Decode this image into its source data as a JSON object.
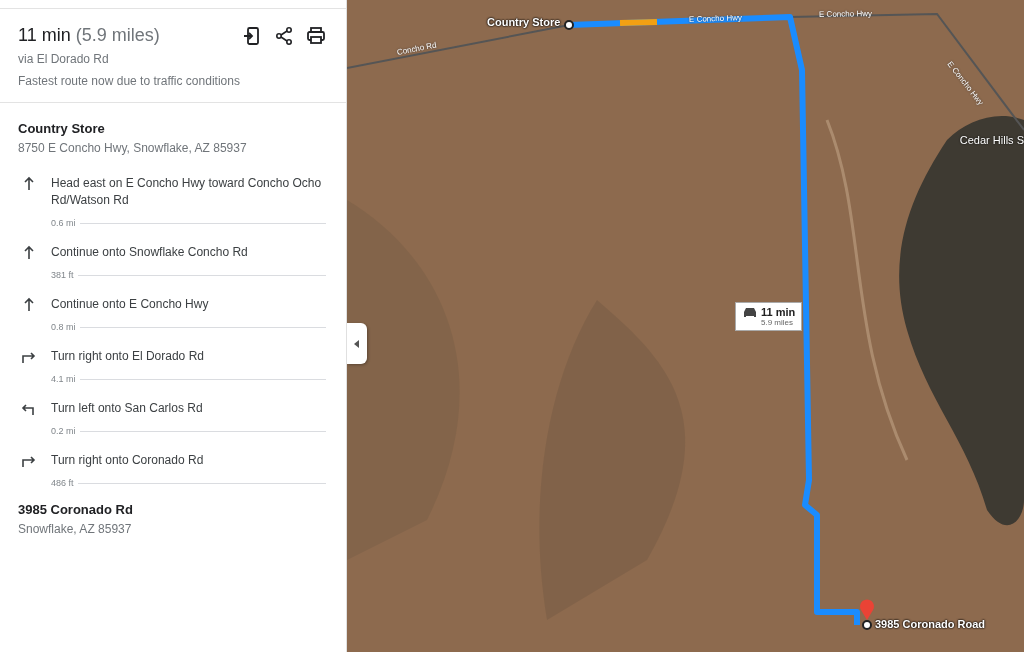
{
  "summary": {
    "duration": "11 min",
    "distance": "(5.9 miles)",
    "via": "via El Dorado Rd",
    "note": "Fastest route now due to traffic conditions"
  },
  "origin": {
    "name": "Country Store",
    "address": "8750 E Concho Hwy, Snowflake, AZ 85937"
  },
  "steps": [
    {
      "kind": "straight",
      "instruction": "Head east on E Concho Hwy toward Concho Ocho Rd/Watson Rd",
      "distance": "0.6 mi"
    },
    {
      "kind": "straight",
      "instruction": "Continue onto Snowflake Concho Rd",
      "distance": "381 ft"
    },
    {
      "kind": "straight",
      "instruction": "Continue onto E Concho Hwy",
      "distance": "0.8 mi"
    },
    {
      "kind": "right",
      "instruction": "Turn right onto El Dorado Rd",
      "distance": "4.1 mi"
    },
    {
      "kind": "left",
      "instruction": "Turn left onto San Carlos Rd",
      "distance": "0.2 mi"
    },
    {
      "kind": "right",
      "instruction": "Turn right onto Coronado Rd",
      "distance": "486 ft"
    }
  ],
  "destination": {
    "name": "3985 Coronado Rd",
    "address": "Snowflake, AZ 85937"
  },
  "map": {
    "origin_label": "Country Store",
    "road_labels": [
      "Concho Rd",
      "E Concho Hwy",
      "E Concho Hwy",
      "E Concho Hwy"
    ],
    "place_label": "Cedar Hills S",
    "route_badge": {
      "duration": "11 min",
      "distance": "5.9 miles"
    },
    "destination_label": "3985 Coronado Road"
  }
}
